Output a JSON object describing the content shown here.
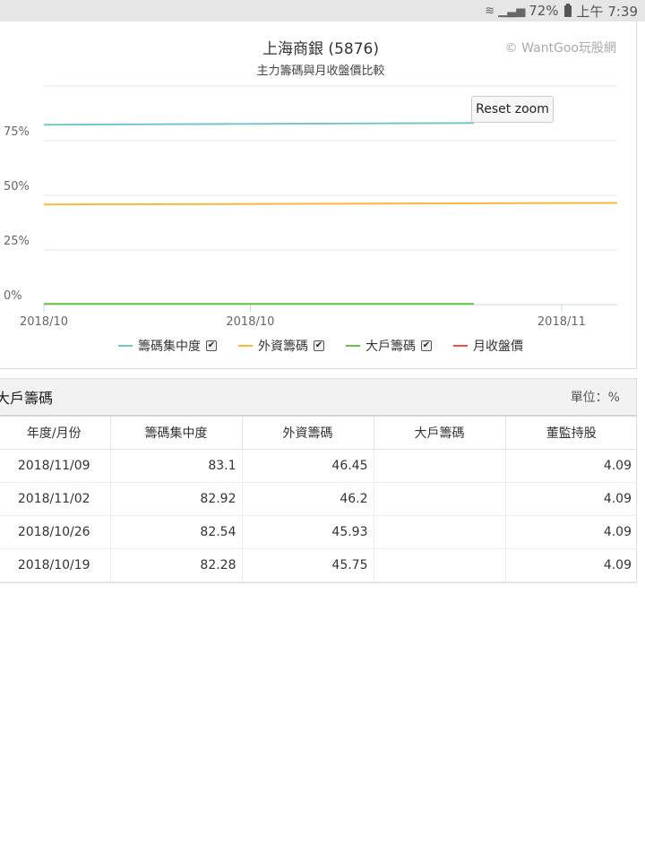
{
  "statusbar": {
    "battery": "72%",
    "time": "上午 7:39"
  },
  "chart": {
    "title": "上海商銀 (5876)",
    "subtitle": "主力籌碼與月收盤價比較",
    "credit": "© WantGoo玩股網",
    "reset_label": "Reset zoom"
  },
  "chart_data": {
    "type": "line",
    "title": "上海商銀 (5876)",
    "subtitle": "主力籌碼與月收盤價比較",
    "x_tick_labels": [
      "2018/10",
      "2018/10",
      "2018/11"
    ],
    "y_tick_labels": [
      "0%",
      "25%",
      "50%",
      "75%"
    ],
    "y_ticks": [
      0,
      25,
      50,
      75
    ],
    "ylim": [
      0,
      100
    ],
    "xlim": [
      0,
      1
    ],
    "grid": true,
    "legend_placement": "bottom",
    "series": [
      {
        "name": "籌碼集中度",
        "color": "#76c6c6",
        "checked": true,
        "x": [
          0,
          0.75
        ],
        "values": [
          82.3,
          83.1
        ]
      },
      {
        "name": "外資籌碼",
        "color": "#f6b93b",
        "checked": true,
        "x": [
          0,
          1.0
        ],
        "values": [
          45.8,
          46.5
        ]
      },
      {
        "name": "大戶籌碼",
        "color": "#6abf4b",
        "checked": true,
        "x": [
          0,
          0.75
        ],
        "values": [
          0.3,
          0.3
        ]
      },
      {
        "name": "月收盤價",
        "color": "#e8524a",
        "checked": false,
        "x": [],
        "values": []
      }
    ]
  },
  "table": {
    "name": "大戶籌碼",
    "unit": "單位：%",
    "columns": [
      "年度/月份",
      "籌碼集中度",
      "外資籌碼",
      "大戶籌碼",
      "董監持股"
    ],
    "rows": [
      [
        "2018/11/09",
        "83.1",
        "46.45",
        "",
        "4.09"
      ],
      [
        "2018/11/02",
        "82.92",
        "46.2",
        "",
        "4.09"
      ],
      [
        "2018/10/26",
        "82.54",
        "45.93",
        "",
        "4.09"
      ],
      [
        "2018/10/19",
        "82.28",
        "45.75",
        "",
        "4.09"
      ]
    ]
  }
}
